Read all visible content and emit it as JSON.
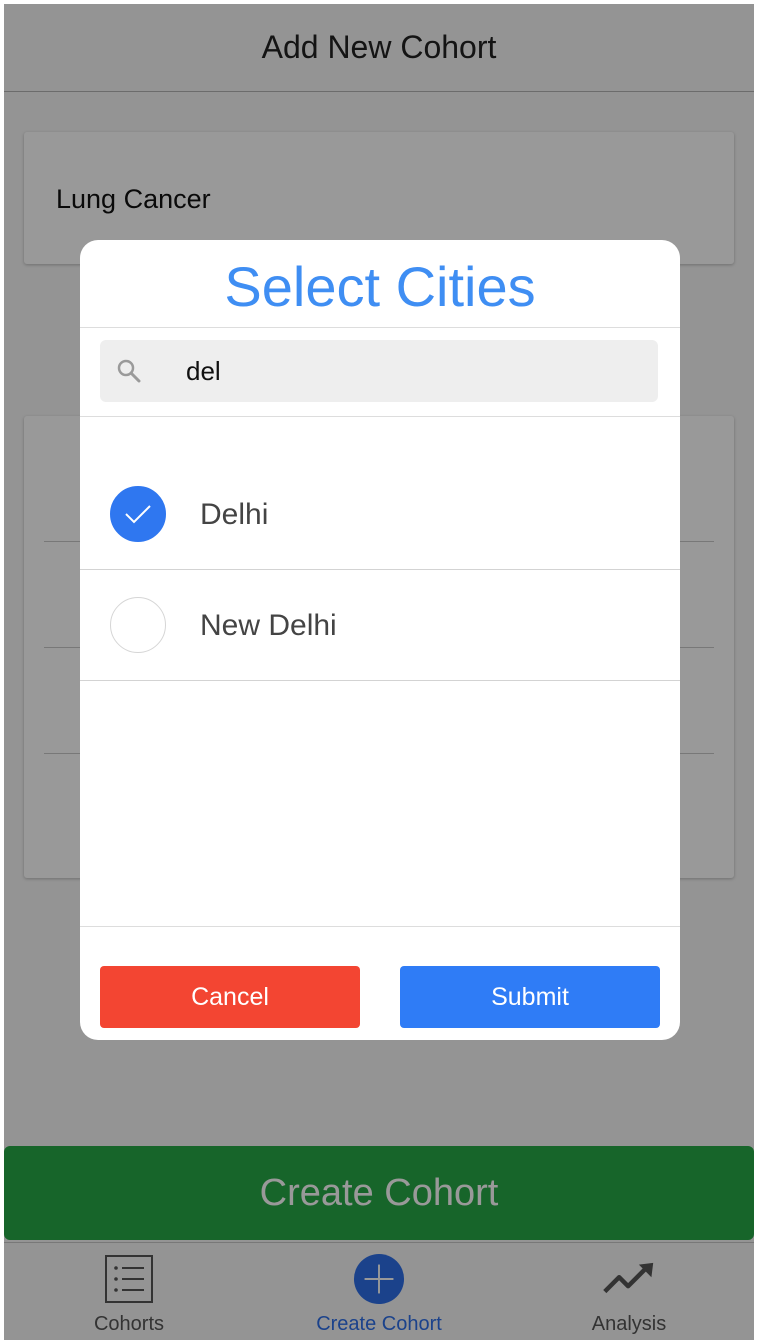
{
  "navbar": {
    "title": "Add New Cohort"
  },
  "form": {
    "cohort_name": "Lung Cancer",
    "create_button": "Create Cohort"
  },
  "tabbar": {
    "tabs": [
      {
        "label": "Cohorts",
        "icon": "list-icon",
        "active": false
      },
      {
        "label": "Create Cohort",
        "icon": "plus-circle-icon",
        "active": true
      },
      {
        "label": "Analysis",
        "icon": "trend-up-icon",
        "active": false
      }
    ]
  },
  "modal": {
    "title": "Select Cities",
    "search": {
      "value": "del",
      "icon": "search-icon"
    },
    "cities": [
      {
        "name": "Delhi",
        "selected": true
      },
      {
        "name": "New Delhi",
        "selected": false
      }
    ],
    "cancel_label": "Cancel",
    "submit_label": "Submit"
  },
  "colors": {
    "title_blue": "#3f8ef3",
    "check_blue": "#2f77f0",
    "cancel_red": "#f34532",
    "submit_blue": "#2f7cf6",
    "create_green": "#27a846",
    "active_tab": "#2d6fe8"
  }
}
